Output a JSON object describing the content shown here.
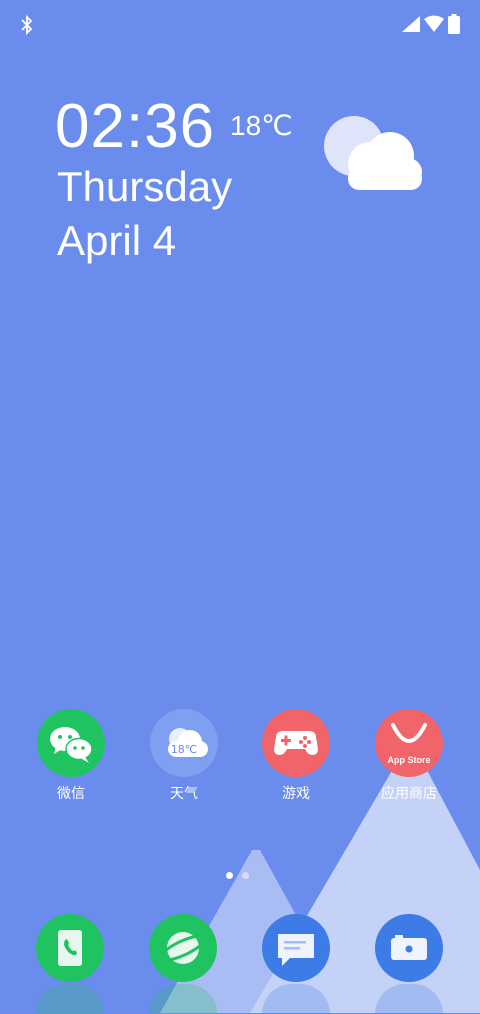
{
  "status_bar": {
    "icons": [
      "bluetooth-icon",
      "signal-icon",
      "wifi-icon",
      "battery-icon"
    ]
  },
  "clock_widget": {
    "time": "02:36",
    "temperature": "18℃",
    "day": "Thursday",
    "date": "April 4",
    "weather_icon": "cloud-icon"
  },
  "apps": [
    {
      "label": "微信",
      "icon": "wechat-icon",
      "color": "#1fc460"
    },
    {
      "label": "天气",
      "icon": "weather-icon",
      "color": "#7f9ff0",
      "badge": "18℃"
    },
    {
      "label": "游戏",
      "icon": "gamepad-icon",
      "color": "#f0646a"
    },
    {
      "label": "应用商店",
      "icon": "app-store-icon",
      "color": "#f0646a",
      "badge": "App Store"
    }
  ],
  "page_indicator": {
    "pages": 2,
    "current": 1
  },
  "dock": [
    {
      "icon": "phone-icon",
      "color": "#1fc460"
    },
    {
      "icon": "browser-icon",
      "color": "#1fc460"
    },
    {
      "icon": "messages-icon",
      "color": "#3d7be6"
    },
    {
      "icon": "camera-icon",
      "color": "#3d7be6"
    }
  ],
  "colors": {
    "wallpaper": "#6a8ced",
    "mountain_front": "#c4d2f7",
    "mountain_back": "#a9bcf3"
  }
}
